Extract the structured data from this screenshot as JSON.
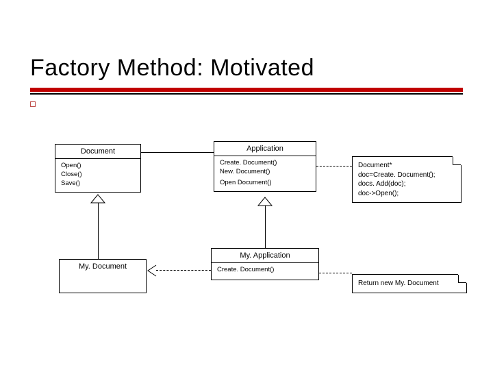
{
  "title": "Factory Method: Motivated",
  "classes": {
    "document": {
      "name": "Document",
      "methods": [
        "Open()",
        "Close()",
        "Save()"
      ]
    },
    "application": {
      "name": "Application",
      "methods": [
        "Create. Document()",
        "New. Document()"
      ],
      "methods2": [
        "Open Document()"
      ]
    },
    "myApplication": {
      "name": "My. Application",
      "methods": [
        "Create. Document()"
      ]
    },
    "myDocument": {
      "name": "My. Document"
    }
  },
  "notes": {
    "appNote": {
      "lines": [
        "Document*",
        "doc=Create. Document();",
        "docs. Add(doc);",
        "doc->Open();"
      ]
    },
    "myAppNote": {
      "text": "Return new My. Document"
    }
  }
}
